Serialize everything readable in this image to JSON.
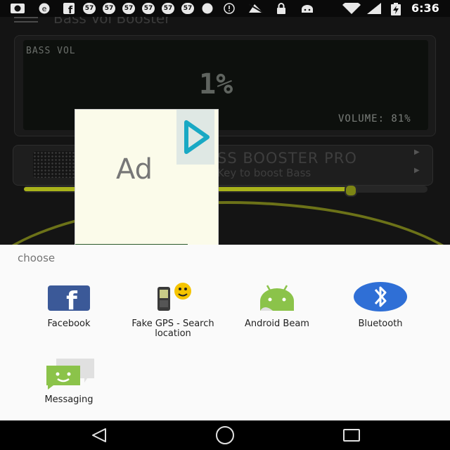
{
  "status_bar": {
    "time": "6:36",
    "icons": [
      "android-head-icon",
      "sync-icon",
      "facebook-icon",
      "tracking-icon",
      "tracking-icon",
      "tracking-icon",
      "tracking-icon",
      "tracking-icon",
      "tracking-icon",
      "info-icon",
      "fake-gps-icon",
      "lock-icon",
      "android-icon",
      "wifi-icon",
      "signal-icon",
      "battery-charging-icon"
    ]
  },
  "background_app": {
    "title": "Bass Vol Booster",
    "display_label": "BASS VOL",
    "percent_text": "1%",
    "volume_text": "VOLUME: 81%",
    "pro_title": "SS BOOSTER PRO",
    "pro_subtitle": "Key to boost Bass",
    "slider_value": 0.81,
    "accent_color": "#a8b21a"
  },
  "ad": {
    "label": "Ad"
  },
  "share_sheet": {
    "title": "choose",
    "apps": [
      {
        "label": "Facebook",
        "icon": "facebook-icon"
      },
      {
        "label": "Fake GPS - Search location",
        "icon": "fake-gps-icon"
      },
      {
        "label": "Android Beam",
        "icon": "android-beam-icon"
      },
      {
        "label": "Bluetooth",
        "icon": "bluetooth-icon"
      },
      {
        "label": "Messaging",
        "icon": "messaging-icon"
      }
    ]
  },
  "nav_bar": {
    "buttons": [
      "back-icon",
      "home-icon",
      "recents-icon"
    ]
  }
}
